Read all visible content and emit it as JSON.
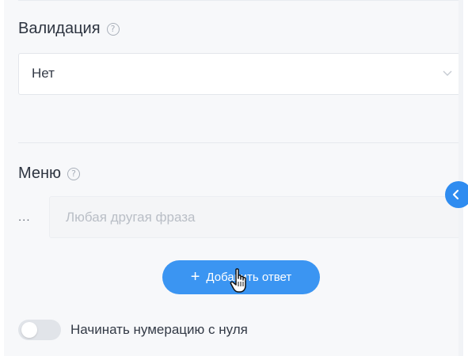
{
  "validation": {
    "label": "Валидация",
    "help_icon": "question-circle-icon",
    "select_value": "Нет",
    "chevron_icon": "chevron-down-icon"
  },
  "menu": {
    "label": "Меню",
    "help_icon": "question-circle-icon",
    "dots": "...",
    "phrase_placeholder": "Любая другая фраза",
    "phrase_value": "",
    "edge_handle_icon": "chevron-left-icon"
  },
  "add_answer": {
    "label": "Добавить ответ",
    "icon": "plus-icon"
  },
  "numbering": {
    "label": "Начинать нумерацию с нуля",
    "enabled": false
  },
  "cursor_icon": "hand-pointer-icon",
  "colors": {
    "accent": "#3b95f2",
    "panel_background": "#f7f8fa",
    "text": "#2d3440",
    "muted": "#a9b0ba"
  }
}
